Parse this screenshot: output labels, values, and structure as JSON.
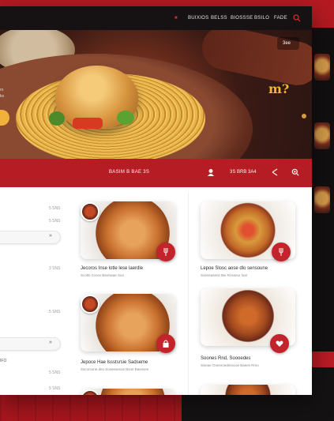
{
  "nav": {
    "items": [
      "■",
      "BUIXIOS",
      "BELSS",
      "BIOSSSE",
      "BSILO",
      "FADE"
    ],
    "active_index": 0
  },
  "hero": {
    "side_text": [
      "ro",
      "ko"
    ],
    "top_right_label": "3ee",
    "logo_text": "m?"
  },
  "bar": {
    "label": "BASIM B BAE 3S",
    "meta": "3S BRB 3A4"
  },
  "sidebar": {
    "numbers": [
      "5 SNS",
      "5 SNS",
      "3 SNS",
      "5 SNS",
      "5 SNS",
      "5 SNS"
    ],
    "chevron": "»",
    "note": "IFO"
  },
  "dishes": [
    {
      "title": "Jecoros Inse lotle lese laerdle",
      "sub": "Scotts Coroo Bsenwae Suo"
    },
    {
      "title": "Lepoe Slosc aose dlo sensoune",
      "sub": "Soeseasens Bie Rosseur loar"
    },
    {
      "title": "Jepoce Hae lssstsrsie Sadseme",
      "sub": "Sscorsone deo Soseesesoe Bsoe Baessee"
    },
    {
      "title": "Soones Rnd, Soooedes",
      "sub": "Siseae Ooesroedesscoe Baees Rrso"
    }
  ],
  "colors": {
    "brand_red": "#b51c24",
    "nav_dark": "#161214",
    "accent_yellow": "#f1b23c"
  }
}
